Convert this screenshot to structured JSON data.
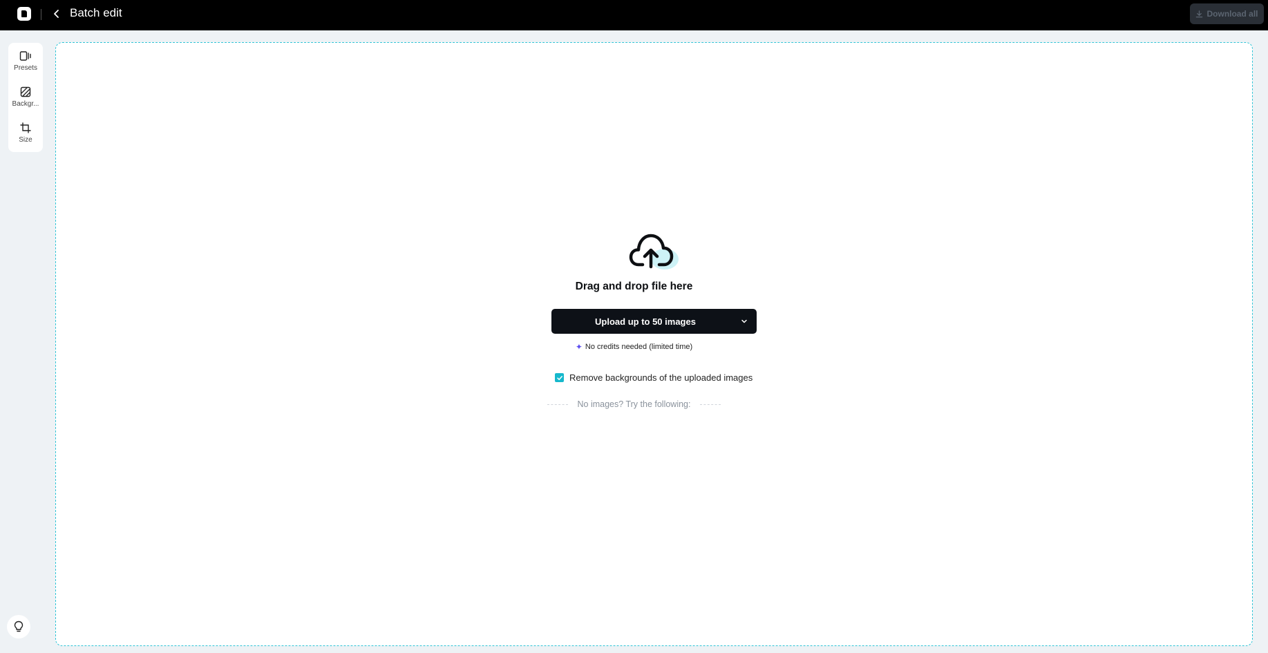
{
  "header": {
    "title": "Batch edit",
    "download_label": "Download all"
  },
  "sidebar": {
    "items": [
      {
        "label": "Presets",
        "icon": "presets-icon"
      },
      {
        "label": "Backgr...",
        "icon": "background-icon"
      },
      {
        "label": "Size",
        "icon": "crop-icon"
      }
    ]
  },
  "dropzone": {
    "title": "Drag and drop file here",
    "upload_label": "Upload up to 50 images",
    "credits_note": "No credits needed (limited time)",
    "remove_bg_label": "Remove backgrounds of the uploaded images",
    "remove_bg_checked": true,
    "try_label": "No images? Try the following:"
  },
  "colors": {
    "accent": "#16b8cc",
    "topbar": "#000000",
    "button_dark": "#0d1117",
    "sparkle": "#5b4df0"
  }
}
